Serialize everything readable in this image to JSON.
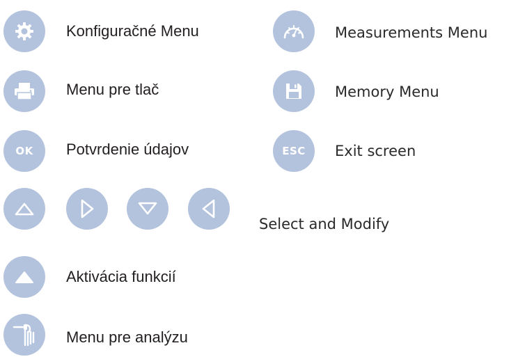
{
  "legend": {
    "left": [
      {
        "icon": "gear-icon",
        "label": "Konfiguračné Menu"
      },
      {
        "icon": "printer-icon",
        "label": "Menu pre tlač"
      },
      {
        "icon": "ok-icon",
        "button_text": "OK",
        "label": "Potvrdenie údajov"
      },
      {
        "icon": "triangle-up-filled-icon",
        "label": "Aktivácia funkcií"
      },
      {
        "icon": "probe-icon",
        "label": "Menu pre analýzu"
      }
    ],
    "right": [
      {
        "icon": "gauge-icon",
        "label": "Measurements Menu"
      },
      {
        "icon": "floppy-disk-icon",
        "label": "Memory Menu"
      },
      {
        "icon": "esc-icon",
        "button_text": "ESC",
        "label": "Exit screen"
      }
    ],
    "arrows": {
      "icons": [
        "arrow-up-icon",
        "arrow-right-icon",
        "arrow-down-icon",
        "arrow-left-icon"
      ],
      "label": "Select and Modify"
    }
  },
  "colors": {
    "button_bg": "#b4c3dd",
    "icon_fg": "#ffffff",
    "text": "#231f20"
  }
}
